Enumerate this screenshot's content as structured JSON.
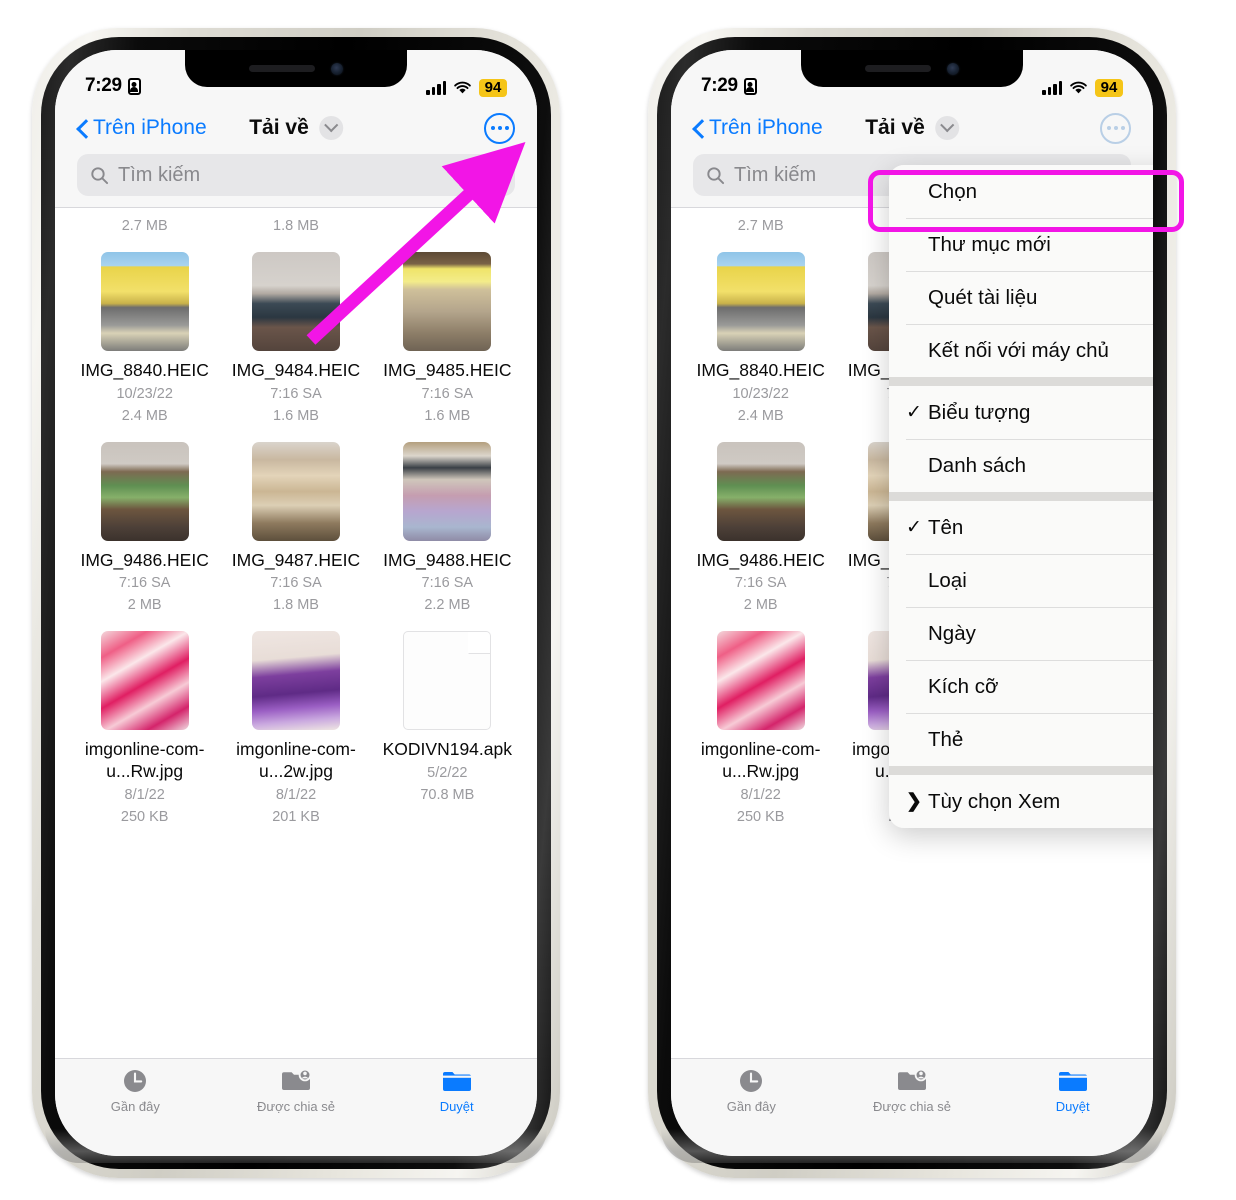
{
  "status_bar": {
    "time": "7:29",
    "battery": "94",
    "lock_icon": "lock-portrait-icon",
    "signal_icon": "cellular-signal-icon",
    "wifi_icon": "wifi-icon"
  },
  "nav": {
    "back_label": "Trên iPhone",
    "title": "Tải về",
    "chevron_icon": "chevron-down-icon",
    "more_icon": "ellipsis-circle-icon"
  },
  "search": {
    "placeholder": "Tìm kiếm",
    "icon": "search-icon"
  },
  "partial_row": {
    "sizes": [
      "2.7 MB",
      "1.8 MB",
      ""
    ]
  },
  "files": [
    {
      "name": "IMG_8840.HEIC",
      "date": "10/23/22",
      "size": "2.4 MB",
      "kind": "photo",
      "thumb": "street-yellow-building"
    },
    {
      "name": "IMG_9484.HEIC",
      "date": "7:16 SA",
      "size": "1.6 MB",
      "kind": "photo",
      "thumb": "room-tv-desk"
    },
    {
      "name": "IMG_9485.HEIC",
      "date": "7:16 SA",
      "size": "1.6 MB",
      "kind": "photo",
      "thumb": "shop-dien-tu-sign"
    },
    {
      "name": "IMG_9486.HEIC",
      "date": "7:16 SA",
      "size": "2 MB",
      "kind": "photo",
      "thumb": "living-room-tv"
    },
    {
      "name": "IMG_9487.HEIC",
      "date": "7:16 SA",
      "size": "1.8 MB",
      "kind": "photo",
      "thumb": "shelf-goods"
    },
    {
      "name": "IMG_9488.HEIC",
      "date": "7:16 SA",
      "size": "2.2 MB",
      "kind": "photo",
      "thumb": "magazine-rack"
    },
    {
      "name": "imgonline-com-u...Rw.jpg",
      "date": "8/1/22",
      "size": "250 KB",
      "kind": "photo",
      "thumb": "pink-flowers"
    },
    {
      "name": "imgonline-com-u...2w.jpg",
      "date": "8/1/22",
      "size": "201 KB",
      "kind": "photo",
      "thumb": "purple-dress"
    },
    {
      "name": "KODIVN194.apk",
      "date": "5/2/22",
      "size": "70.8 MB",
      "kind": "document",
      "thumb": "generic-document"
    }
  ],
  "tabs": [
    {
      "label": "Gần đây",
      "icon": "clock-icon",
      "active": false
    },
    {
      "label": "Được chia sẻ",
      "icon": "shared-folder-icon",
      "active": false
    },
    {
      "label": "Duyệt",
      "icon": "folder-icon",
      "active": true
    }
  ],
  "context_menu": {
    "groups": [
      {
        "items": [
          {
            "label": "Chọn",
            "icon": "checkmark-circle-icon",
            "checked": false,
            "highlighted": true
          },
          {
            "label": "Thư mục mới",
            "icon": "folder-plus-icon",
            "checked": false,
            "highlighted": false
          },
          {
            "label": "Quét tài liệu",
            "icon": "document-scanner-icon",
            "checked": false,
            "highlighted": false
          },
          {
            "label": "Kết nối với máy chủ",
            "icon": "server-display-icon",
            "checked": false,
            "highlighted": false
          }
        ]
      },
      {
        "items": [
          {
            "label": "Biểu tượng",
            "icon": "grid-view-icon",
            "checked": true,
            "highlighted": false
          },
          {
            "label": "Danh sách",
            "icon": "list-view-icon",
            "checked": false,
            "highlighted": false
          }
        ]
      },
      {
        "items": [
          {
            "label": "Tên",
            "icon": "chevron-up-icon",
            "checked": true,
            "highlighted": false
          },
          {
            "label": "Loại",
            "icon": "",
            "checked": false,
            "highlighted": false
          },
          {
            "label": "Ngày",
            "icon": "",
            "checked": false,
            "highlighted": false
          },
          {
            "label": "Kích cỡ",
            "icon": "",
            "checked": false,
            "highlighted": false
          },
          {
            "label": "Thẻ",
            "icon": "",
            "checked": false,
            "highlighted": false
          }
        ]
      },
      {
        "items": [
          {
            "label": "Tùy chọn Xem",
            "icon": "",
            "checked": false,
            "highlighted": false,
            "leading_arrow": true
          }
        ]
      }
    ]
  },
  "annotations": {
    "arrow_color": "#f215e6",
    "highlight_color": "#f215e6",
    "arrow_target": "ellipsis-circle-icon",
    "highlight_target": "Chọn"
  }
}
